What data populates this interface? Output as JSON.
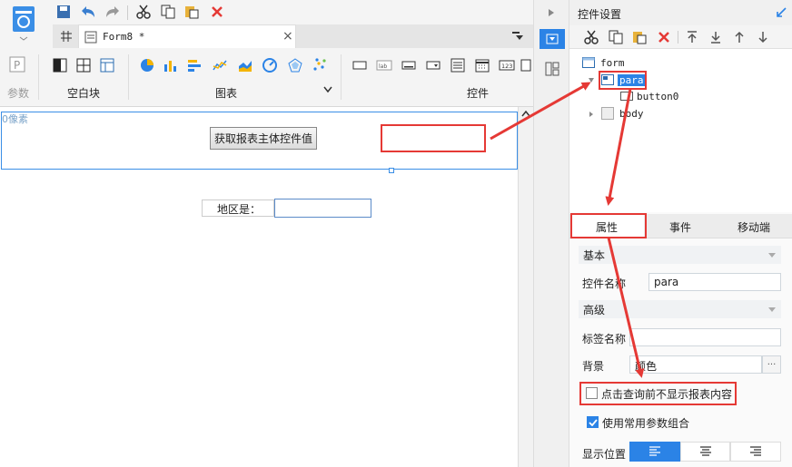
{
  "toolbar": {
    "param_label": "参数",
    "blank_label": "空白块",
    "chart_label": "图表",
    "widget_label": "控件"
  },
  "tab": {
    "title": "Form8 *",
    "close": "×"
  },
  "canvas": {
    "pixel_note": "0像素",
    "button_label": "获取报表主体控件值",
    "region_label": "地区是："
  },
  "panel": {
    "title": "控件设置",
    "tree": {
      "form": "form",
      "para": "para",
      "button0": "button0",
      "body": "body"
    },
    "tabs": {
      "props": "属性",
      "events": "事件",
      "mobile": "移动端"
    },
    "basic": "基本",
    "name_label": "控件名称",
    "name_value": "para",
    "advanced": "高级",
    "tag_label": "标签名称",
    "tag_value": "",
    "bg_label": "背景",
    "bg_value": "颜色",
    "bg_more": "···",
    "chk1": "点击查询前不显示报表内容",
    "chk1_checked": false,
    "chk2": "使用常用参数组合",
    "chk2_checked": true,
    "pos_label": "显示位置"
  },
  "colors": {
    "accent": "#2b83e6",
    "red": "#e53935",
    "selected": "#2b83e6"
  }
}
